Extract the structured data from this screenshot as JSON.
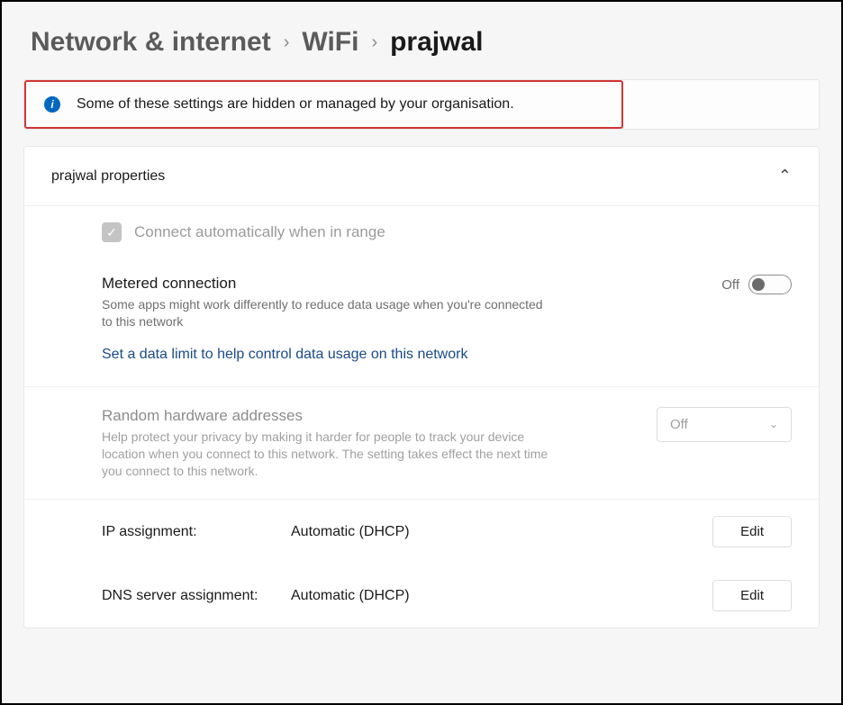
{
  "breadcrumb": {
    "l0": "Network & internet",
    "l1": "WiFi",
    "l2": "prajwal"
  },
  "info": {
    "text": "Some of these settings are hidden or managed by your organisation."
  },
  "panel": {
    "title": "prajwal properties"
  },
  "autoConnect": {
    "label": "Connect automatically when in range"
  },
  "metered": {
    "title": "Metered connection",
    "desc": "Some apps might work differently to reduce data usage when you're connected to this network",
    "state": "Off",
    "link": "Set a data limit to help control data usage on this network"
  },
  "random": {
    "title": "Random hardware addresses",
    "desc": "Help protect your privacy by making it harder for people to track your device location when you connect to this network. The setting takes effect the next time you connect to this network.",
    "value": "Off"
  },
  "ip": {
    "key": "IP assignment:",
    "val": "Automatic (DHCP)",
    "btn": "Edit"
  },
  "dns": {
    "key": "DNS server assignment:",
    "val": "Automatic (DHCP)",
    "btn": "Edit"
  }
}
